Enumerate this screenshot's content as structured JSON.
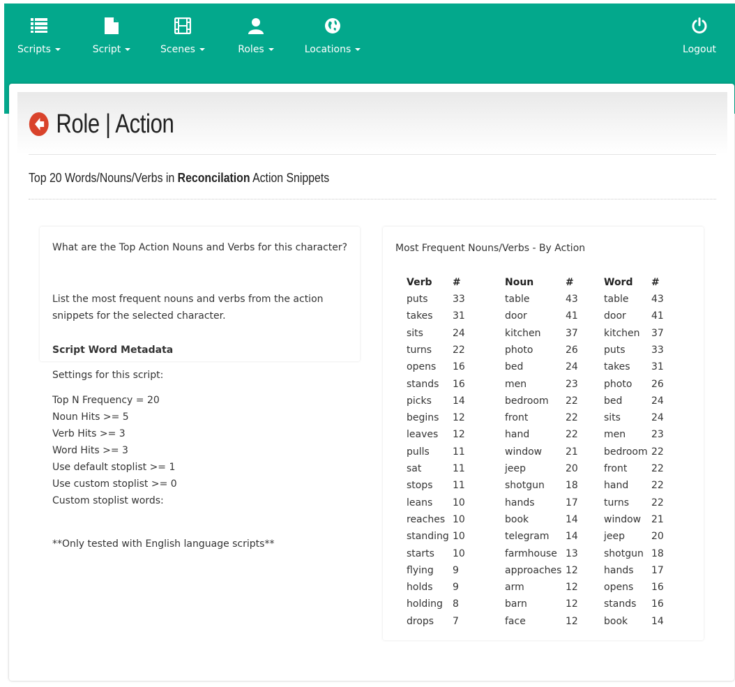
{
  "nav": {
    "items": [
      {
        "label": "Scripts",
        "icon": "list-icon"
      },
      {
        "label": "Script",
        "icon": "document-icon"
      },
      {
        "label": "Scenes",
        "icon": "film-icon"
      },
      {
        "label": "Roles",
        "icon": "user-icon"
      },
      {
        "label": "Locations",
        "icon": "globe-icon"
      }
    ],
    "logout_label": "Logout"
  },
  "page": {
    "title": "Role | Action",
    "subtitle_prefix": "Top 20 Words/Nouns/Verbs in ",
    "subtitle_bold": "Reconcilation",
    "subtitle_suffix": " Action Snippets"
  },
  "left_panel": {
    "question": "What are the Top Action Nouns and Verbs for this character?",
    "description": "List the most frequent nouns and verbs from the action snippets for the selected character.",
    "metadata_heading": "Script Word Metadata",
    "settings_label": "Settings for this script:",
    "settings": [
      "Top N Frequency = 20",
      "Noun Hits >= 5",
      "Verb Hits >= 3",
      "Word Hits >= 3",
      "Use default stoplist >= 1",
      "Use custom stoplist >= 0",
      "Custom stoplist words:"
    ],
    "note": "**Only tested with English language scripts**"
  },
  "right_panel": {
    "title": "Most Frequent Nouns/Verbs - By Action",
    "headers": {
      "verb": "Verb",
      "noun": "Noun",
      "word": "Word",
      "count": "#"
    },
    "rows": [
      {
        "verb": "puts",
        "vn": "33",
        "noun": "table",
        "nn": "43",
        "word": "table",
        "wn": "43"
      },
      {
        "verb": "takes",
        "vn": "31",
        "noun": "door",
        "nn": "41",
        "word": "door",
        "wn": "41"
      },
      {
        "verb": "sits",
        "vn": "24",
        "noun": "kitchen",
        "nn": "37",
        "word": "kitchen",
        "wn": "37"
      },
      {
        "verb": "turns",
        "vn": "22",
        "noun": "photo",
        "nn": "26",
        "word": "puts",
        "wn": "33"
      },
      {
        "verb": "opens",
        "vn": "16",
        "noun": "bed",
        "nn": "24",
        "word": "takes",
        "wn": "31"
      },
      {
        "verb": "stands",
        "vn": "16",
        "noun": "men",
        "nn": "23",
        "word": "photo",
        "wn": "26"
      },
      {
        "verb": "picks",
        "vn": "14",
        "noun": "bedroom",
        "nn": "22",
        "word": "bed",
        "wn": "24"
      },
      {
        "verb": "begins",
        "vn": "12",
        "noun": "front",
        "nn": "22",
        "word": "sits",
        "wn": "24"
      },
      {
        "verb": "leaves",
        "vn": "12",
        "noun": "hand",
        "nn": "22",
        "word": "men",
        "wn": "23"
      },
      {
        "verb": "pulls",
        "vn": "11",
        "noun": "window",
        "nn": "21",
        "word": "bedroom",
        "wn": "22"
      },
      {
        "verb": "sat",
        "vn": "11",
        "noun": "jeep",
        "nn": "20",
        "word": "front",
        "wn": "22"
      },
      {
        "verb": "stops",
        "vn": "11",
        "noun": "shotgun",
        "nn": "18",
        "word": "hand",
        "wn": "22"
      },
      {
        "verb": "leans",
        "vn": "10",
        "noun": "hands",
        "nn": "17",
        "word": "turns",
        "wn": "22"
      },
      {
        "verb": "reaches",
        "vn": "10",
        "noun": "book",
        "nn": "14",
        "word": "window",
        "wn": "21"
      },
      {
        "verb": "standing",
        "vn": "10",
        "noun": "telegram",
        "nn": "14",
        "word": "jeep",
        "wn": "20"
      },
      {
        "verb": "starts",
        "vn": "10",
        "noun": "farmhouse",
        "nn": "13",
        "word": "shotgun",
        "wn": "18"
      },
      {
        "verb": "flying",
        "vn": "9",
        "noun": "approaches",
        "nn": "12",
        "word": "hands",
        "wn": "17"
      },
      {
        "verb": "holds",
        "vn": "9",
        "noun": "arm",
        "nn": "12",
        "word": "opens",
        "wn": "16"
      },
      {
        "verb": "holding",
        "vn": "8",
        "noun": "barn",
        "nn": "12",
        "word": "stands",
        "wn": "16"
      },
      {
        "verb": "drops",
        "vn": "7",
        "noun": "face",
        "nn": "12",
        "word": "book",
        "wn": "14"
      }
    ]
  },
  "colors": {
    "nav": "#03a88c",
    "back_icon": "#d9432b"
  }
}
